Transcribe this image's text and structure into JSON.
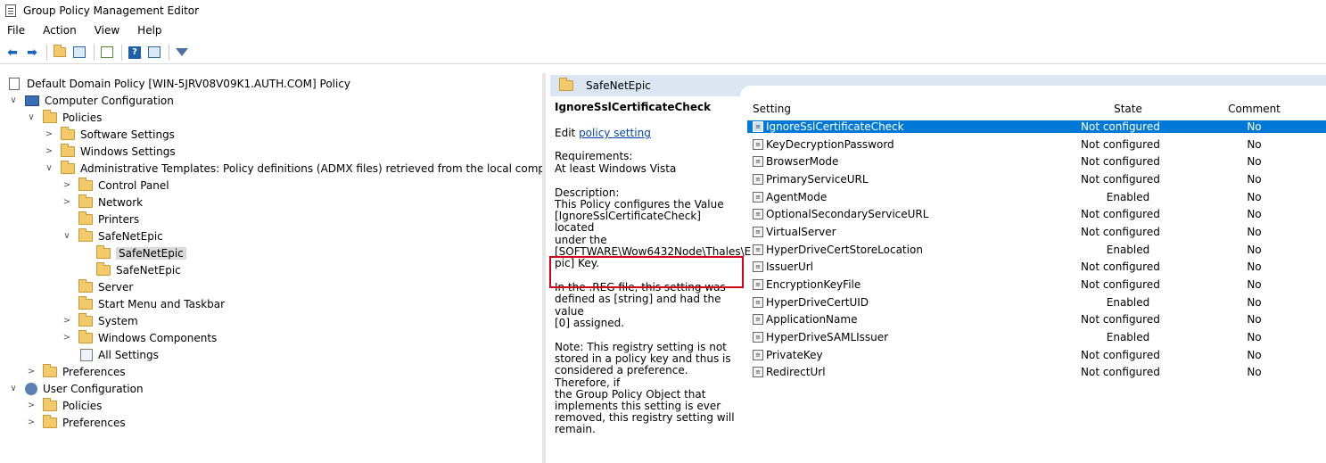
{
  "window": {
    "title": "Group Policy Management Editor"
  },
  "menu": [
    "File",
    "Action",
    "View",
    "Help"
  ],
  "toolbar": {
    "icons": [
      "back-arrow-icon",
      "forward-arrow-icon",
      "up-folder-icon",
      "show-hide-tree-icon",
      "export-list-icon",
      "help-icon",
      "properties-icon",
      "filter-icon"
    ]
  },
  "tree": {
    "root": "Default Domain Policy [WIN-5JRV08V09K1.AUTH.COM] Policy",
    "computer_config": "Computer Configuration",
    "policies": "Policies",
    "software_settings": "Software Settings",
    "windows_settings": "Windows Settings",
    "admin_templates": "Administrative Templates: Policy definitions (ADMX files) retrieved from the local computer.",
    "control_panel": "Control Panel",
    "network": "Network",
    "printers": "Printers",
    "safenetepic_parent": "SafeNetEpic",
    "safenetepic_child1": "SafeNetEpic",
    "safenetepic_child2": "SafeNetEpic",
    "server": "Server",
    "start_menu": "Start Menu and Taskbar",
    "system": "System",
    "windows_components": "Windows Components",
    "all_settings": "All Settings",
    "preferences": "Preferences",
    "user_config": "User Configuration",
    "user_policies": "Policies",
    "user_preferences": "Preferences"
  },
  "right_pane": {
    "header": "SafeNetEpic",
    "description": {
      "heading": "IgnoreSslCertificateCheck",
      "edit_prefix": "Edit ",
      "edit_link": "policy setting",
      "requirements_label": "Requirements:",
      "requirements_value": "At least Windows Vista",
      "description_label": "Description:",
      "description_line1": "This Policy configures the Value",
      "description_line2": "[IgnoreSslCertificateCheck] located",
      "description_line3": "under the",
      "description_line4": "[SOFTWARE\\Wow6432Node\\Thales\\E",
      "description_line5": "pic] Key.",
      "reg_line1": "In the .REG file, this setting was",
      "reg_line2": "defined as [string] and had the value",
      "reg_line3": "[0] assigned.",
      "note_line1": "Note:  This registry setting is not",
      "note_line2": "stored in a policy key and thus is",
      "note_line3": "considered a preference.  Therefore, if",
      "note_line4": "the Group Policy Object that",
      "note_line5": "implements this setting is ever",
      "note_line6": "removed, this registry setting will",
      "note_line7": "remain."
    },
    "columns": {
      "setting": "Setting",
      "state": "State",
      "comment": "Comment"
    },
    "rows": [
      {
        "setting": "IgnoreSslCertificateCheck",
        "state": "Not configured",
        "comment": "No"
      },
      {
        "setting": "KeyDecryptionPassword",
        "state": "Not configured",
        "comment": "No"
      },
      {
        "setting": "BrowserMode",
        "state": "Not configured",
        "comment": "No"
      },
      {
        "setting": "PrimaryServiceURL",
        "state": "Not configured",
        "comment": "No"
      },
      {
        "setting": "AgentMode",
        "state": "Enabled",
        "comment": "No"
      },
      {
        "setting": "OptionalSecondaryServiceURL",
        "state": "Not configured",
        "comment": "No"
      },
      {
        "setting": "VirtualServer",
        "state": "Not configured",
        "comment": "No"
      },
      {
        "setting": "HyperDriveCertStoreLocation",
        "state": "Enabled",
        "comment": "No"
      },
      {
        "setting": "IssuerUrl",
        "state": "Not configured",
        "comment": "No"
      },
      {
        "setting": "EncryptionKeyFile",
        "state": "Not configured",
        "comment": "No"
      },
      {
        "setting": "HyperDriveCertUID",
        "state": "Enabled",
        "comment": "No"
      },
      {
        "setting": "ApplicationName",
        "state": "Not configured",
        "comment": "No"
      },
      {
        "setting": "HyperDriveSAMLIssuer",
        "state": "Enabled",
        "comment": "No"
      },
      {
        "setting": "PrivateKey",
        "state": "Not configured",
        "comment": "No"
      },
      {
        "setting": "RedirectUrl",
        "state": "Not configured",
        "comment": "No"
      }
    ],
    "selected_row": 0
  },
  "colors": {
    "selection": "#0078d7",
    "header_band": "#dce6f2",
    "highlight_box": "#d0021b",
    "link": "#0645ad"
  }
}
